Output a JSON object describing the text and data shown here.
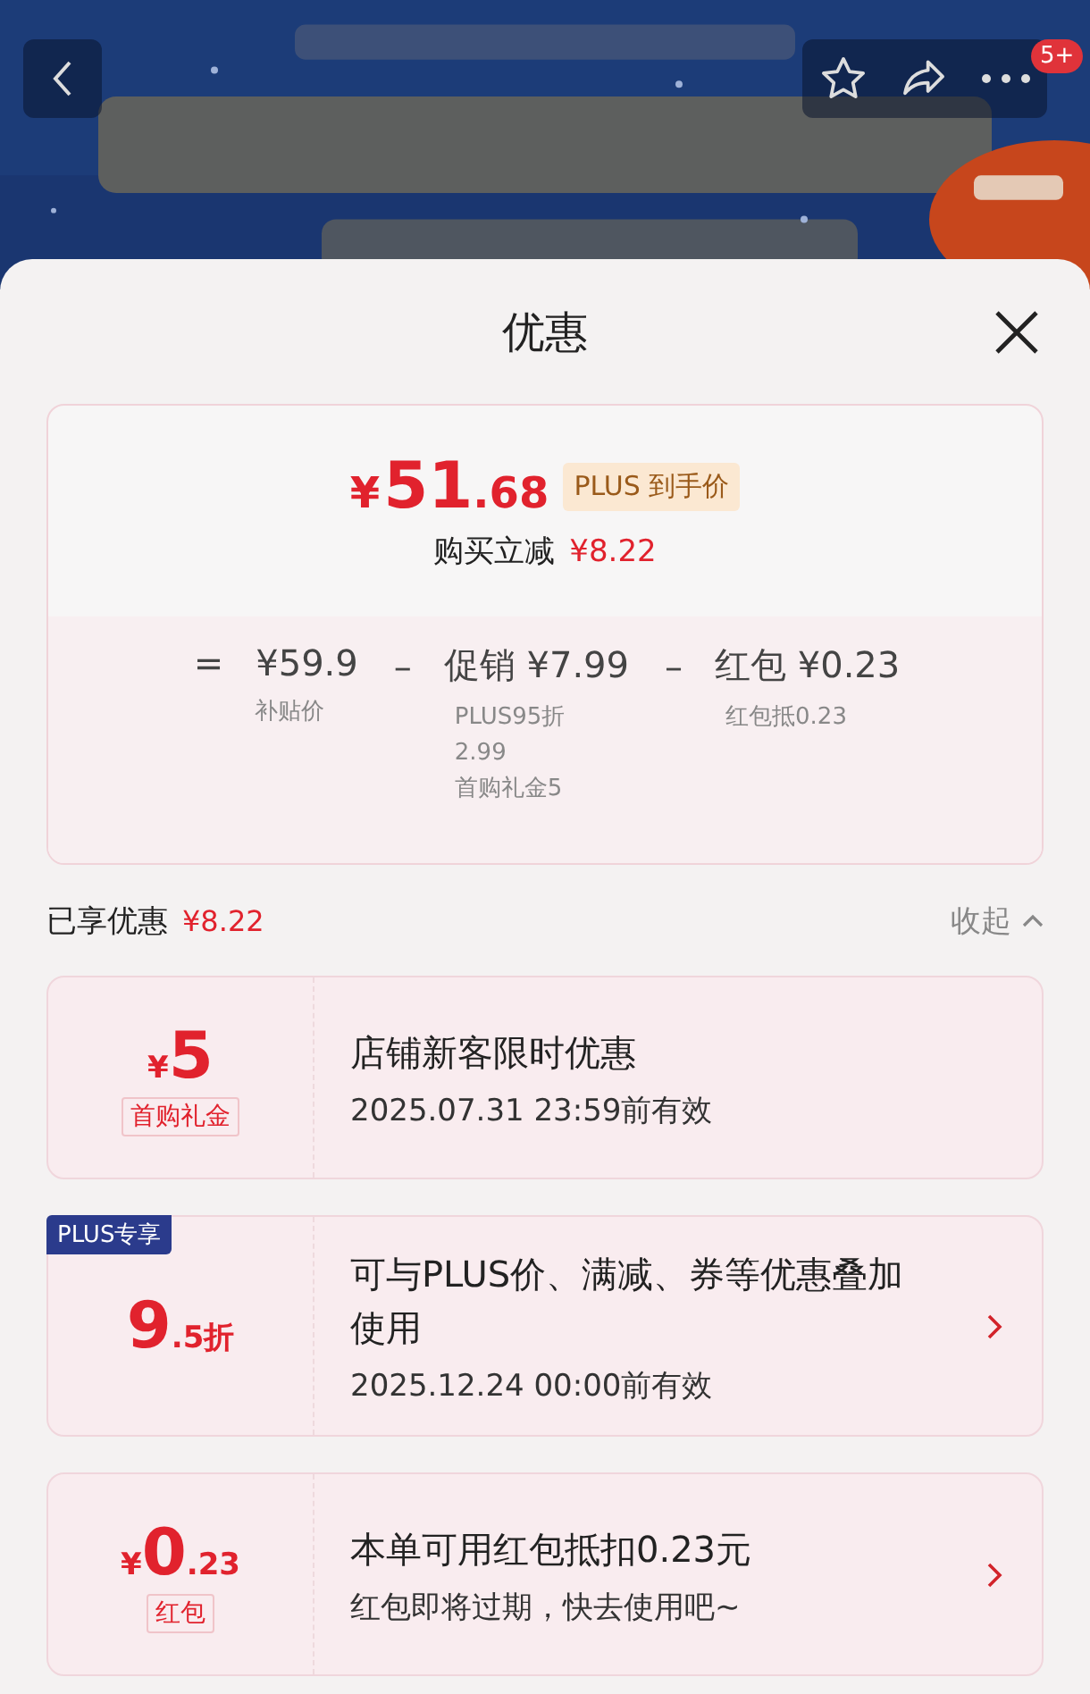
{
  "top_bar": {
    "badge": "5+"
  },
  "sheet": {
    "title": "优惠"
  },
  "summary": {
    "symbol": "¥",
    "price_int": "51",
    "price_dec": ".68",
    "price_tag": "PLUS 到手价",
    "saving_label": "购买立减",
    "saving_value": "¥8.22",
    "breakdown": [
      {
        "op": "=",
        "amount": "¥59.9",
        "notes": [
          "补贴价"
        ]
      },
      {
        "op": "–",
        "amount": "促销 ¥7.99",
        "notes": [
          "PLUS95折",
          "2.99",
          "首购礼金5"
        ]
      },
      {
        "op": "–",
        "amount": "红包 ¥0.23",
        "notes": [
          "红包抵0.23"
        ]
      }
    ]
  },
  "enjoyed": {
    "label": "已享优惠",
    "value": "¥8.22",
    "toggle": "收起",
    "expanded": true
  },
  "coupons": [
    {
      "kind": "amount",
      "symbol": "¥",
      "main": "5",
      "tag": "首购礼金",
      "title": "店铺新客限时优惠",
      "subtitle": "2025.07.31 23:59前有效",
      "has_arrow": false
    },
    {
      "kind": "discount",
      "badge": "PLUS专享",
      "main": "9",
      "minor": ".5折",
      "title": "可与PLUS价、满减、券等优惠叠加使用",
      "subtitle": "2025.12.24 00:00前有效",
      "has_arrow": true
    },
    {
      "kind": "amount",
      "symbol": "¥",
      "main": "0",
      "minor": ".23",
      "tag": "红包",
      "title": "本单可用红包抵扣0.23元",
      "subtitle": "红包即将过期，快去使用吧~",
      "has_arrow": true
    }
  ]
}
